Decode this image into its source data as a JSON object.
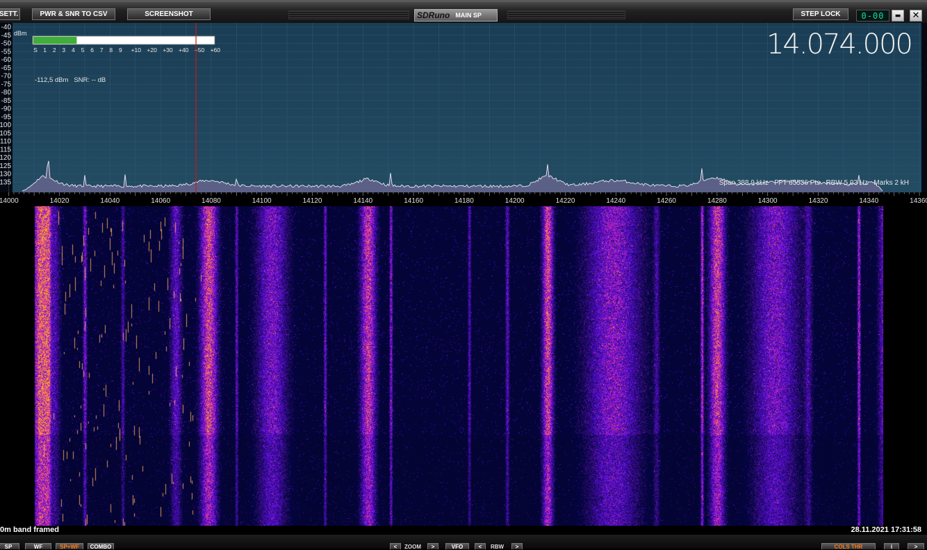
{
  "titlebar": {
    "sett_label": "SETT.",
    "csv_label": "PWR & SNR TO CSV",
    "screenshot_label": "SCREENSHOT",
    "brand": "SDRuno",
    "subtitle": "MAIN SP",
    "step_lock_label": "STEP LOCK",
    "lcd_value": "0-00",
    "minimize_symbol": "▬",
    "close_symbol": "✕"
  },
  "spectrum": {
    "frequency_display": "14.074.000",
    "dbm_unit": "dBm",
    "dbm_scale": [
      "-40",
      "-45",
      "-50",
      "-55",
      "-60",
      "-65",
      "-70",
      "-75",
      "-80",
      "-85",
      "-90",
      "-95",
      "-100",
      "-105",
      "-110",
      "-115",
      "-120",
      "-125",
      "-130",
      "-135"
    ],
    "smeter_scale": [
      "S",
      "1",
      "2",
      "3",
      "4",
      "5",
      "6",
      "7",
      "8",
      "9",
      "+10",
      "+20",
      "+30",
      "+40",
      "+50",
      "+60"
    ],
    "smeter_level": 0.24,
    "level_readout": "-112,5 dBm   SNR: -- dB",
    "info_text": "Span 388,9 kHz   FFT 65536 Pts   RBW 5,93 Hz   Marks 2 kH",
    "freq_ticks": [
      "14000",
      "14020",
      "14040",
      "14060",
      "14080",
      "14100",
      "14120",
      "14140",
      "14160",
      "14180",
      "14200",
      "14220",
      "14240",
      "14260",
      "14280",
      "14300",
      "14320",
      "14340",
      "14360"
    ],
    "tuned_khz": 14074,
    "axis_range_khz": [
      13996.5,
      14363
    ]
  },
  "status": {
    "left_text": "0m band framed",
    "right_text": "28.11.2021 17:31:58"
  },
  "bottombar": {
    "sp_label": "SP",
    "wf_label": "WF",
    "spwf_label": "SP+WF",
    "combo_label": "COMBO",
    "zoom_label": "ZOOM",
    "vfo_label": "VFO",
    "rbw_label": "RBW",
    "left_arrow": "<",
    "right_arrow": ">",
    "colour_label": "COLS THR",
    "extra_label": "i"
  },
  "colors": {
    "spectrum_background": "#183a4f",
    "grid": "#2e5570",
    "trace": "#e8e8f2",
    "fill": "#5f6189",
    "marker": "#cc1818",
    "smeter_bar": "#3fae3a",
    "lcd_text": "#18d7b0",
    "active_button_text": "#ff7a1a"
  }
}
